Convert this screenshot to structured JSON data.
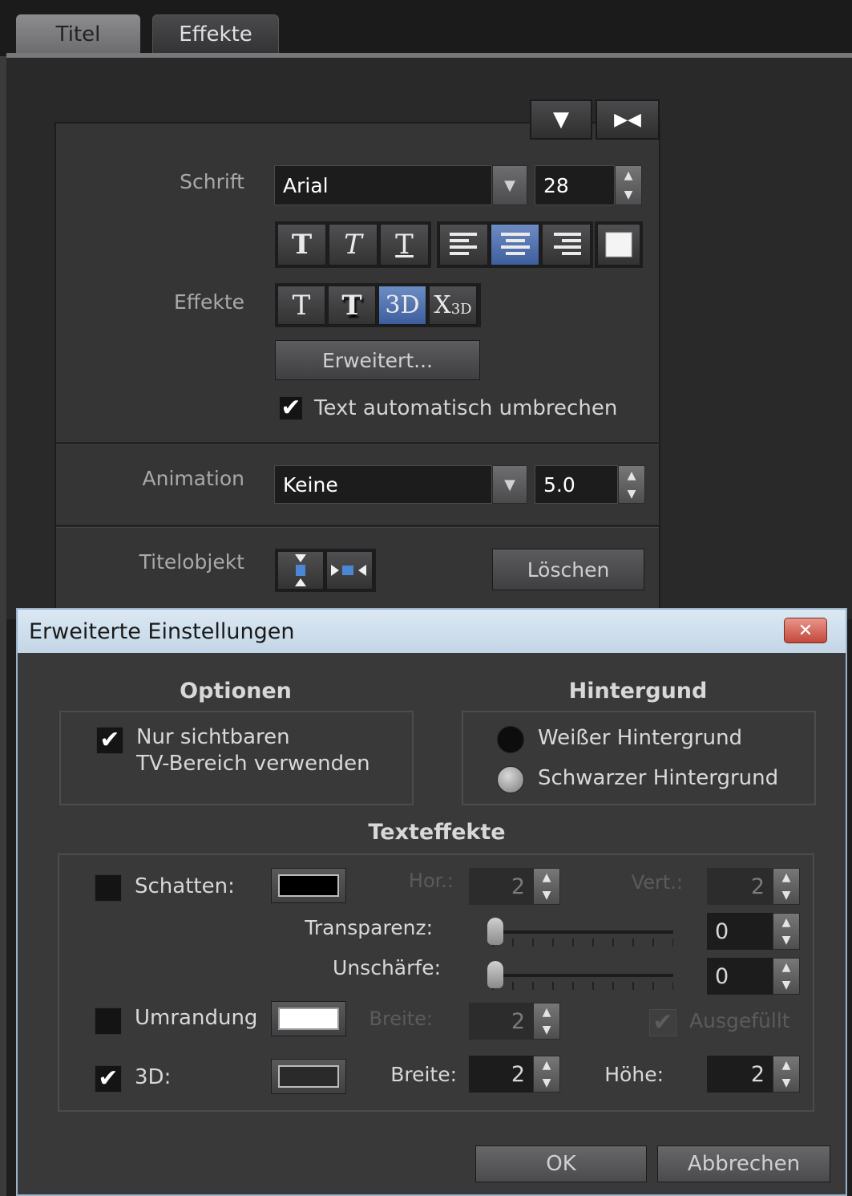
{
  "tabs": [
    {
      "label": "Titel",
      "active": true
    },
    {
      "label": "Effekte",
      "active": false
    }
  ],
  "corner_buttons": {
    "collapse_icon": "▼",
    "fit_icon": "▶◀"
  },
  "panel": {
    "font": {
      "label": "Schrift",
      "value": "Arial",
      "size": "28"
    },
    "style_buttons": [
      "T",
      "T",
      "T"
    ],
    "effects": {
      "label": "Effekte",
      "buttons": [
        "T",
        "T",
        "3D",
        "X"
      ],
      "x3d_sub": "3D"
    },
    "advanced_button": "Erweitert...",
    "wrap": {
      "label": "Text automatisch umbrechen",
      "checked": true
    },
    "animation": {
      "label": "Animation",
      "value": "Keine",
      "duration": "5.0"
    },
    "title_object": {
      "label": "Titelobjekt",
      "delete_button": "Löschen"
    }
  },
  "dialog": {
    "title": "Erweiterte Einstellungen",
    "close_glyph": "✕",
    "options": {
      "heading": "Optionen",
      "tv_area_line1": "Nur sichtbaren",
      "tv_area_line2": "TV-Bereich verwenden",
      "tv_area_checked": true
    },
    "background": {
      "heading": "Hintergund",
      "white": "Weißer Hintergrund",
      "black": "Schwarzer Hintergrund",
      "selected": "white"
    },
    "text_effects": {
      "heading": "Texteffekte",
      "shadow": {
        "label": "Schatten:",
        "checked": false,
        "hor_label": "Hor.:",
        "hor": "2",
        "vert_label": "Vert.:",
        "vert": "2",
        "color": "#000000"
      },
      "transparency": {
        "label": "Transparenz:",
        "value": "0"
      },
      "blur": {
        "label": "Unschärfe:",
        "value": "0"
      },
      "outline": {
        "label": "Umrandung",
        "checked": false,
        "width_label": "Breite:",
        "width": "2",
        "filled_label": "Ausgefüllt",
        "color": "#ffffff"
      },
      "three_d": {
        "label": "3D:",
        "checked": true,
        "width_label": "Breite:",
        "width": "2",
        "height_label": "Höhe:",
        "height": "2",
        "color": "#2a2a2a"
      }
    },
    "ok_button": "OK",
    "cancel_button": "Abbrechen"
  },
  "colors": {
    "accent_selected": "#4a6aa8",
    "dialog_title_bg": "#c8dae9",
    "close_red": "#c9493c"
  }
}
